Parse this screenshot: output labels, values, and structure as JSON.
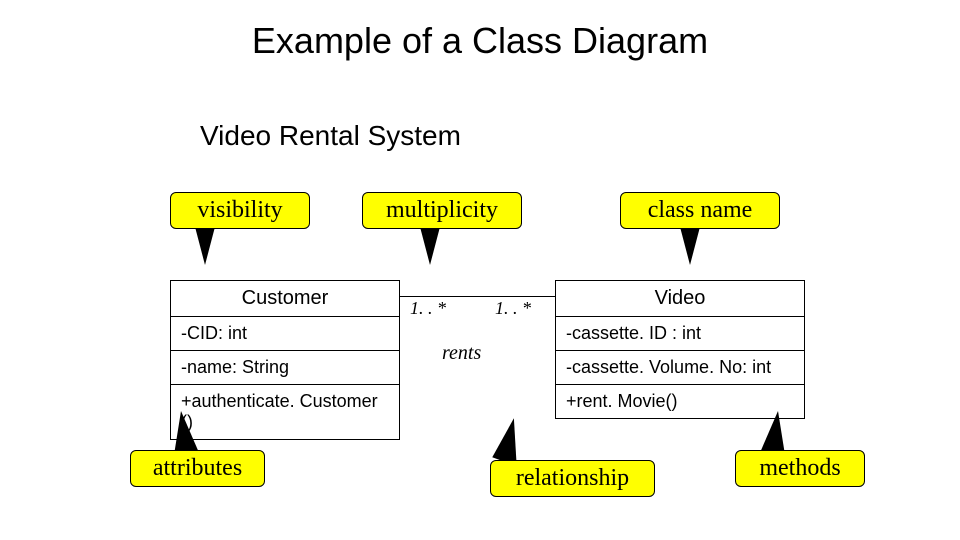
{
  "title": "Example of a Class Diagram",
  "subtitle": "Video Rental System",
  "callouts": {
    "visibility": "visibility",
    "multiplicity": "multiplicity",
    "class_name": "class name",
    "attributes": "attributes",
    "relationship": "relationship",
    "methods": "methods"
  },
  "classes": {
    "customer": {
      "name": "Customer",
      "attrs": [
        "-CID:  int",
        "-name:  String"
      ],
      "methods": [
        "+authenticate. Customer ()"
      ]
    },
    "video": {
      "name": "Video",
      "attrs": [
        "-cassette. ID : int",
        "-cassette. Volume. No:  int"
      ],
      "methods": [
        "+rent. Movie()"
      ]
    }
  },
  "association": {
    "left_mult": "1. . *",
    "right_mult": "1. . *",
    "label": "rents"
  }
}
